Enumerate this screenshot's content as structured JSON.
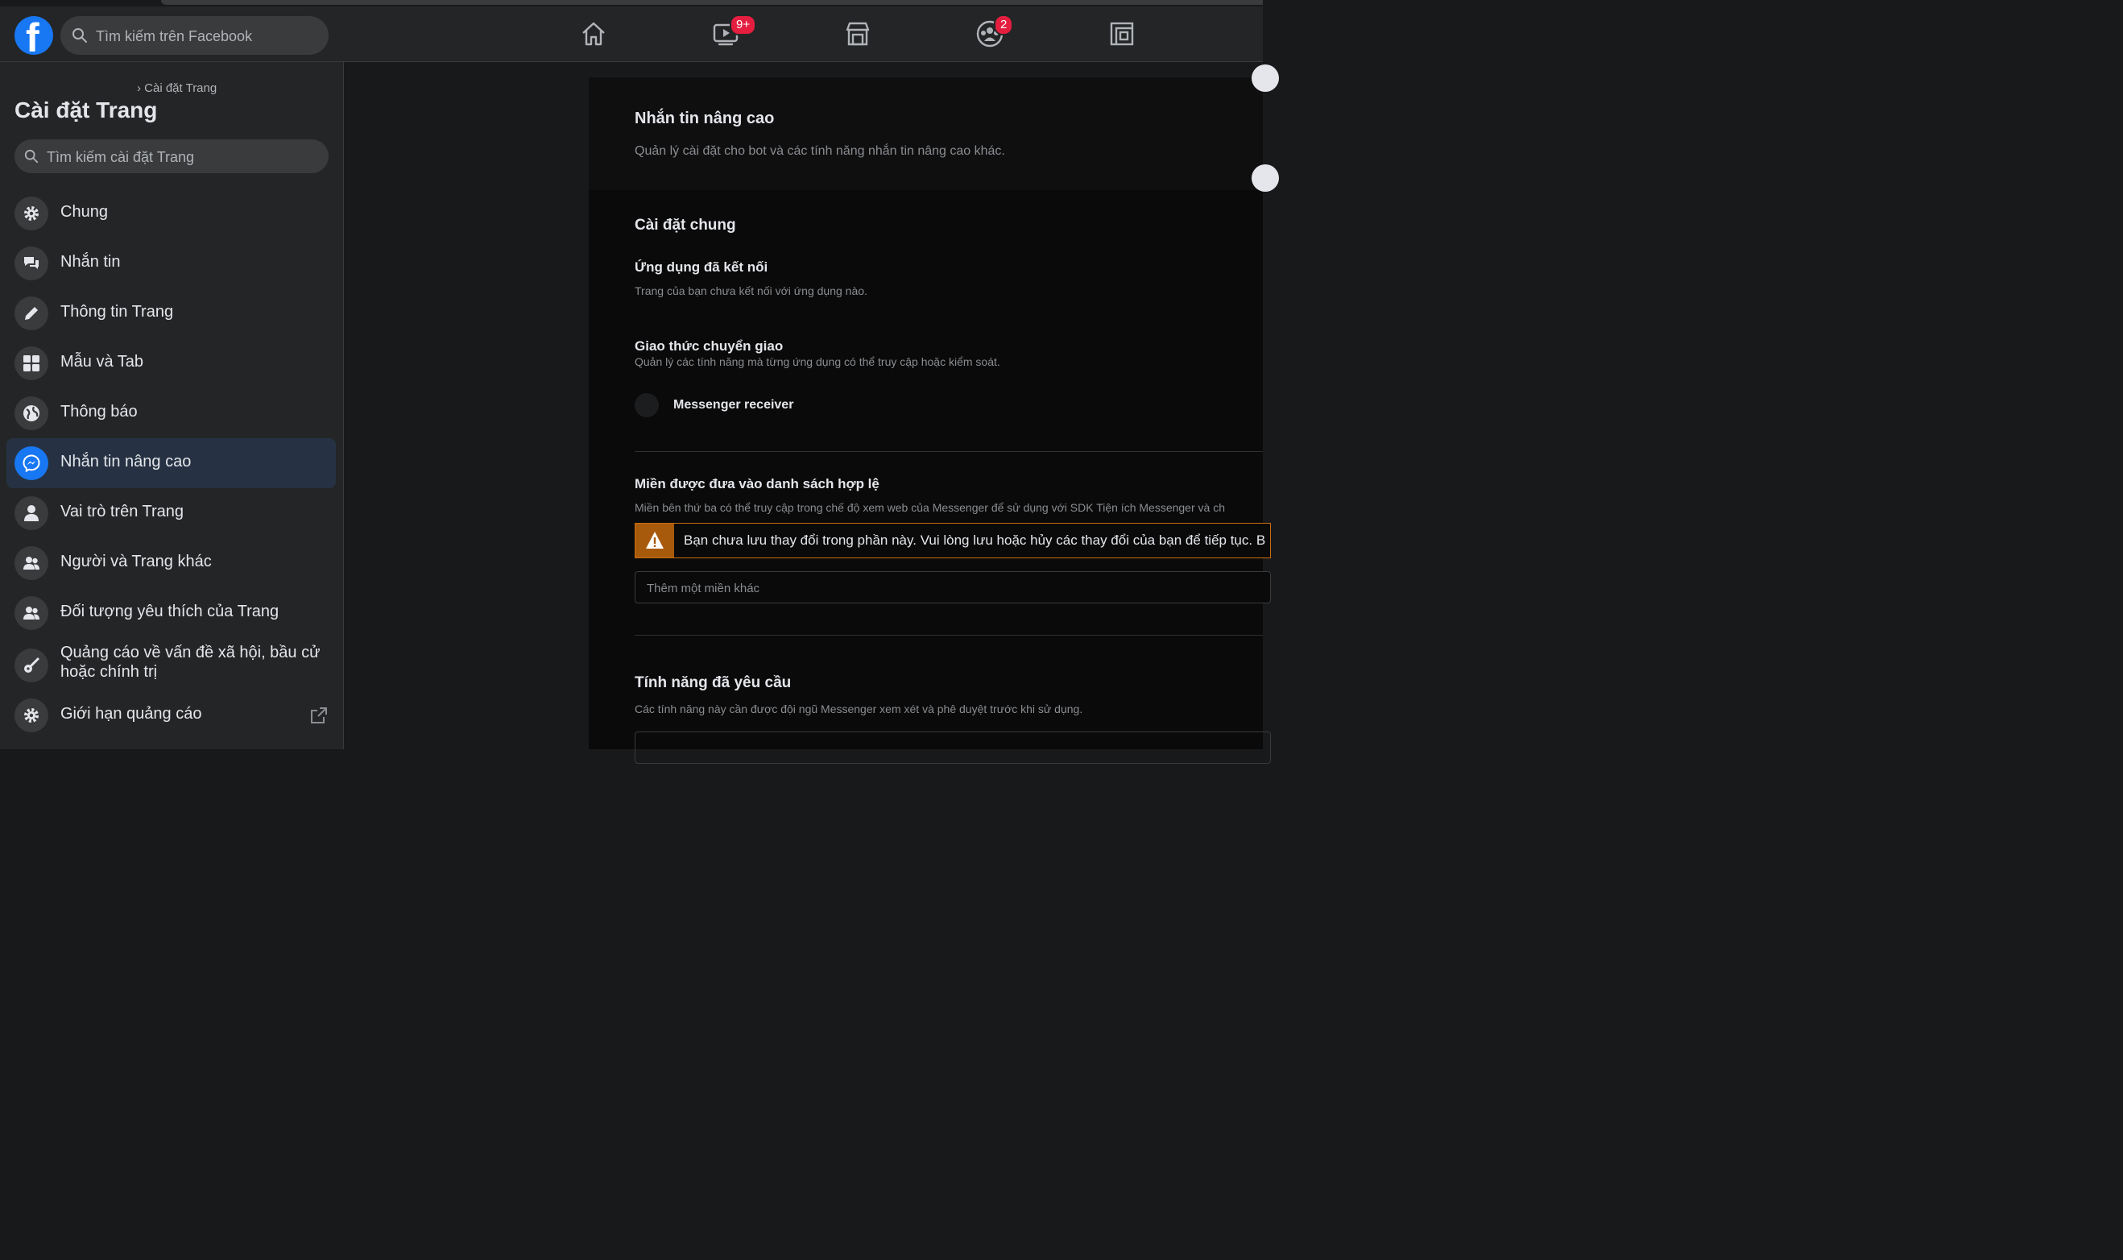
{
  "topbar": {
    "search_placeholder": "Tìm kiếm trên Facebook",
    "watch_badge": "9+",
    "groups_badge": "2"
  },
  "sidebar": {
    "breadcrumb": "› Cài đặt Trang",
    "title": "Cài đặt Trang",
    "search_placeholder": "Tìm kiếm cài đặt Trang",
    "items": [
      {
        "label": "Chung",
        "icon": "gear-icon"
      },
      {
        "label": "Nhắn tin",
        "icon": "chat-bubbles-icon"
      },
      {
        "label": "Thông tin Trang",
        "icon": "pencil-icon"
      },
      {
        "label": "Mẫu và Tab",
        "icon": "grid-icon"
      },
      {
        "label": "Thông báo",
        "icon": "globe-icon"
      },
      {
        "label": "Nhắn tin nâng cao",
        "icon": "messenger-icon",
        "active": true
      },
      {
        "label": "Vai trò trên Trang",
        "icon": "person-icon"
      },
      {
        "label": "Người và Trang khác",
        "icon": "people-icon"
      },
      {
        "label": "Đối tượng yêu thích của Trang",
        "icon": "people-icon"
      },
      {
        "label": "Quảng cáo về vấn đề xã hội, bầu cử hoặc chính trị",
        "icon": "guitar-icon"
      },
      {
        "label": "Giới hạn quảng cáo",
        "icon": "gear-icon"
      }
    ]
  },
  "content": {
    "title": "Nhắn tin nâng cao",
    "subtitle": "Quản lý cài đặt cho bot và các tính năng nhắn tin nâng cao khác.",
    "general_title": "Cài đặt chung",
    "connected_apps_title": "Ứng dụng đã kết nối",
    "connected_apps_desc": "Trang của bạn chưa kết nối với ứng dụng nào.",
    "handover_title": "Giao thức chuyển giao",
    "handover_desc": "Quản lý các tính năng mà từng ứng dụng có thể truy cập hoặc kiểm soát.",
    "messenger_receiver": "Messenger receiver",
    "whitelist_title": "Miền được đưa vào danh sách hợp lệ",
    "whitelist_desc": "Miền bên thứ ba có thể truy cập trong chế độ xem web của Messenger để sử dụng với SDK Tiện ích Messenger và ch",
    "warning_text": "Bạn chưa lưu thay đổi trong phần này. Vui lòng lưu hoặc hủy các thay đổi của bạn để tiếp tục. B",
    "domain_placeholder": "Thêm một miền khác",
    "requested_title": "Tính năng đã yêu cầu",
    "requested_desc": "Các tính năng này cần được đội ngũ Messenger xem xét và phê duyệt trước khi sử dụng."
  }
}
